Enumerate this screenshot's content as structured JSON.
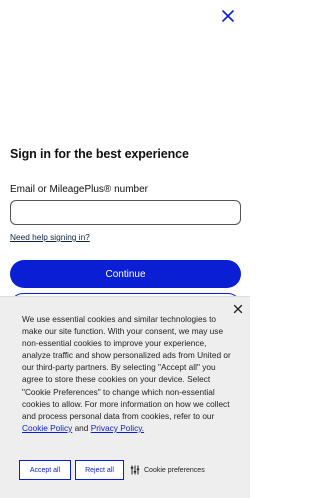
{
  "header": {
    "close_icon": "close-icon"
  },
  "signin": {
    "heading": "Sign in for the best experience",
    "field_label": "Email or MileagePlus® number",
    "field_value": "",
    "help_link": "Need help signing in?",
    "continue_label": "Continue"
  },
  "cookie": {
    "text_before": "We use essential cookies and similar technologies to make our site function. With your consent, we may use non-essential cookies to improve your experience, analyze traffic and show personalized ads from United or our third-party partners. By selecting \"Accept all\" you agree to store these cookies on your device. Select \"Cookie Preferences\" to change which non-essential cookies to allow. For more information on how we collect and process personal data from cookies, refer to our ",
    "cookie_policy_link": "Cookie Policy",
    "text_and": " and ",
    "privacy_policy_link": "Privacy Policy.",
    "accept_label": "Accept all",
    "reject_label": "Reject all",
    "preferences_label": "Cookie preferences"
  },
  "colors": {
    "accent": "#0a1fd4",
    "panel_bg": "#eeeeee"
  }
}
